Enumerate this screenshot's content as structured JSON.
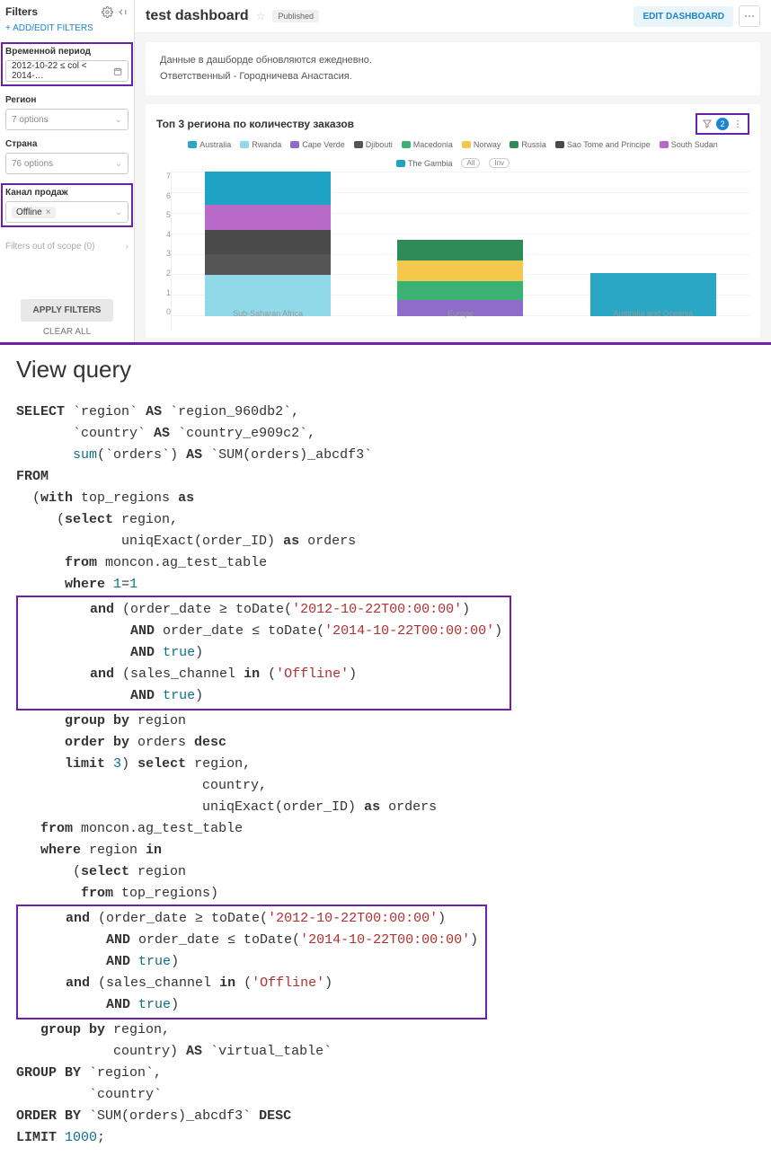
{
  "sidebar": {
    "title": "Filters",
    "add_edit": "ADD/EDIT FILTERS",
    "groups": {
      "time": {
        "label": "Временной период",
        "value": "2012-10-22 ≤ col < 2014-…"
      },
      "region": {
        "label": "Регион",
        "placeholder": "7 options"
      },
      "country": {
        "label": "Страна",
        "placeholder": "76 options"
      },
      "channel": {
        "label": "Канал продаж",
        "chip": "Offline"
      }
    },
    "out_of_scope": "Filters out of scope (0)",
    "apply": "APPLY FILTERS",
    "clear": "CLEAR ALL"
  },
  "header": {
    "title": "test dashboard",
    "published": "Published",
    "edit": "EDIT DASHBOARD"
  },
  "info": {
    "line1": "Данные в дашборде обновляются ежедневно.",
    "line2": "Ответственный - Городничева Анастасия."
  },
  "chart": {
    "title": "Топ 3 региона по количеству заказов",
    "filter_count": "2",
    "all": "All",
    "inv": "Inv"
  },
  "chart_data": {
    "type": "bar",
    "stacked": true,
    "ylabel": "",
    "xlabel": "",
    "ylim": [
      0,
      7
    ],
    "yticks": [
      0,
      1,
      2,
      3,
      4,
      5,
      6,
      7
    ],
    "categories": [
      "Sub-Saharan Africa",
      "Europe",
      "Australia and Oceania"
    ],
    "series": [
      {
        "name": "Australia",
        "color": "#2aa7c5",
        "values": [
          0,
          0,
          2.1
        ]
      },
      {
        "name": "Rwanda",
        "color": "#8fd9e8",
        "values": [
          2.0,
          0,
          0
        ]
      },
      {
        "name": "Cape Verde",
        "color": "#8e6cc9",
        "values": [
          0,
          0.8,
          0
        ]
      },
      {
        "name": "Djibouti",
        "color": "#555555",
        "values": [
          1.0,
          0,
          0
        ]
      },
      {
        "name": "Macedonia",
        "color": "#3bb273",
        "values": [
          0,
          0.9,
          0
        ]
      },
      {
        "name": "Norway",
        "color": "#f2c94c",
        "values": [
          0,
          1.0,
          0
        ]
      },
      {
        "name": "Russia",
        "color": "#2e8b57",
        "values": [
          0,
          1.0,
          0
        ]
      },
      {
        "name": "Sao Tome and Principe",
        "color": "#4a4a4a",
        "values": [
          1.2,
          0,
          0
        ]
      },
      {
        "name": "South Sudan",
        "color": "#b96ac9",
        "values": [
          1.2,
          0,
          0
        ]
      },
      {
        "name": "The Gambia",
        "color": "#1fa3c4",
        "values": [
          1.6,
          0,
          0
        ]
      }
    ]
  },
  "query": {
    "title": "View query",
    "aliases": {
      "region": "region_960db2",
      "country": "country_e909c2",
      "sum": "SUM(orders)_abcdf3"
    },
    "table": "moncon.ag_test_table",
    "dates": {
      "from": "2012-10-22T00:00:00",
      "to": "2014-10-22T00:00:00"
    },
    "channel": "Offline",
    "limit_inner": "3",
    "limit_outer": "1000",
    "virtual": "virtual_table"
  }
}
